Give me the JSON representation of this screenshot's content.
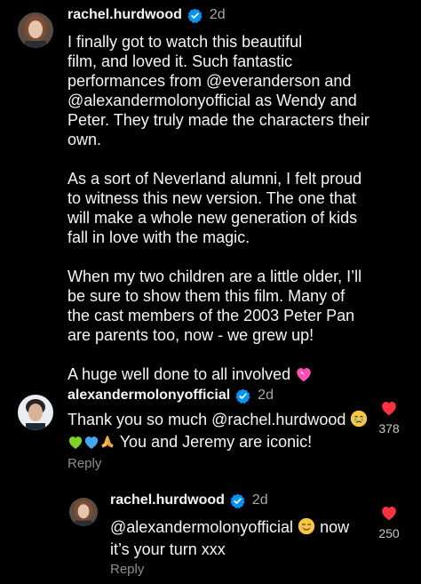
{
  "comment1": {
    "username": "rachel.hurdwood",
    "time": "2d",
    "paragraphs": [
      [
        "I finally got to watch this beautiful",
        "film, and loved it. Such fantastic",
        "performances from @everanderson and",
        "@alexandermolonyofficial as Wendy and",
        "Peter. They truly made the characters their",
        "own."
      ],
      [
        "As a sort of Neverland alumni, I felt proud",
        "to witness this new version. The one that",
        "will make a whole new generation of kids",
        "fall in love with the magic."
      ],
      [
        "When my two children are a little older, I’ll",
        "be sure to show them this film. Many of",
        "the cast members of the 2003 Peter Pan",
        "are parents too, now - we grew up!"
      ]
    ],
    "last_line": "A huge well done to all involved"
  },
  "comment2": {
    "username": "alexandermolonyofficial",
    "time": "2d",
    "line1": "Thank you so much @rachel.hurdwood",
    "line2": "You and Jeremy are iconic!",
    "likes": "378",
    "reply": "Reply"
  },
  "comment3": {
    "username": "rachel.hurdwood",
    "time": "2d",
    "line1": "@alexandermolonyofficial",
    "line1_after": "now",
    "line2": "it’s your turn xxx",
    "likes": "250",
    "reply": "Reply"
  },
  "icons": {
    "verified": "verified-badge-icon",
    "heart": "heart-filled-icon",
    "pink_heart": "pink-heart-emoji",
    "crying": "crying-face-emoji",
    "green_heart": "green-heart-emoji",
    "blue_heart": "blue-heart-emoji",
    "pray": "folded-hands-emoji",
    "smiling": "smiling-face-emoji"
  },
  "colors": {
    "background": "#000000",
    "verified": "#0095f6",
    "heart": "#ff3040",
    "secondary_text": "#a8a8a8"
  }
}
